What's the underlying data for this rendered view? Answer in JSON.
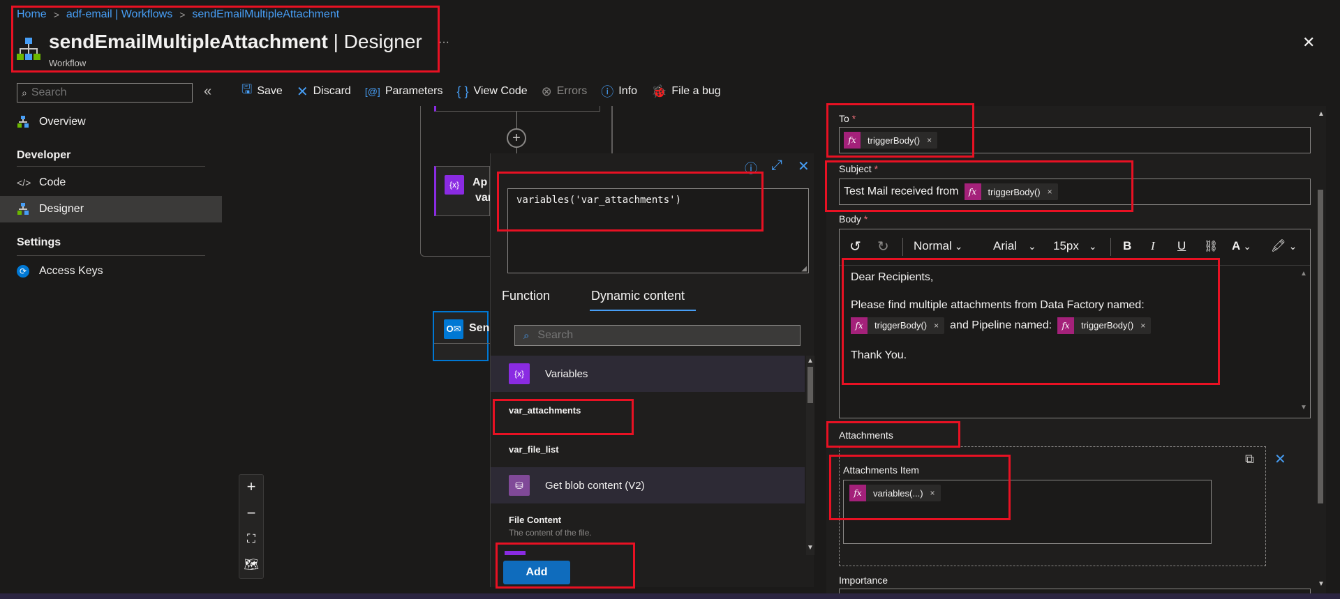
{
  "breadcrumb": {
    "items": [
      "Home",
      "adf-email | Workflows",
      "sendEmailMultipleAttachment"
    ]
  },
  "header": {
    "title": "sendEmailMultipleAttachment",
    "title_suffix": "| Designer",
    "subtitle": "Workflow",
    "more": "···",
    "close": "✕"
  },
  "sidebar": {
    "search_placeholder": "Search",
    "collapse": "«",
    "overview": "Overview",
    "section_developer": "Developer",
    "code": "Code",
    "designer": "Designer",
    "section_settings": "Settings",
    "access_keys": "Access Keys"
  },
  "toolbar": {
    "save": "Save",
    "discard": "Discard",
    "parameters": "Parameters",
    "view_code": "View Code",
    "errors": "Errors",
    "info": "Info",
    "file_bug": "File a bug"
  },
  "canvas": {
    "card1_title": "Ap",
    "card1_sub": "var",
    "card2_title": "Sen"
  },
  "zoom": {
    "in": "+",
    "out": "−",
    "fit": "⛶",
    "map": "🗺"
  },
  "expression_panel": {
    "expression": "variables('var_attachments')",
    "tab_function": "Function",
    "tab_dynamic": "Dynamic content",
    "search_placeholder": "Search",
    "group_variables": "Variables",
    "item_var_attachments": "var_attachments",
    "item_var_file_list": "var_file_list",
    "group_blob": "Get blob content (V2)",
    "item_file_content": "File Content",
    "item_file_content_desc": "The content of the file.",
    "add_button": "Add"
  },
  "form": {
    "to_label": "To",
    "to_token": "triggerBody()",
    "subject_label": "Subject",
    "subject_text": "Test Mail received from",
    "subject_token": "triggerBody()",
    "body_label": "Body",
    "required_mark": "*",
    "rte": {
      "style": "Normal",
      "font": "Arial",
      "size": "15px",
      "bold": "B",
      "italic": "I",
      "underline": "U",
      "font_color": "A"
    },
    "body_line1": "Dear Recipients,",
    "body_line2": "Please find multiple attachments from Data Factory named:",
    "body_token1": "triggerBody()",
    "body_mid": "and Pipeline named:",
    "body_token2": "triggerBody()",
    "body_line3": "Thank You.",
    "attachments_label": "Attachments",
    "attachments_item_label": "Attachments Item",
    "attachments_token": "variables(...)",
    "importance_label": "Importance"
  },
  "colors": {
    "accent": "#479ef5",
    "highlight": "#e81123",
    "token_fx": "#a4217a",
    "variables_icon": "#8a2be2"
  }
}
